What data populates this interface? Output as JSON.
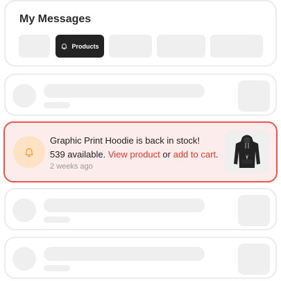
{
  "header": {
    "title": "My Messages",
    "tabs": [
      {
        "label": ""
      },
      {
        "label": "Products",
        "icon": "bell-icon",
        "active": true
      },
      {
        "label": ""
      },
      {
        "label": ""
      },
      {
        "label": ""
      }
    ]
  },
  "notification": {
    "line1": "Graphic Print Hoodie is back in stock!",
    "count_text": "539 available.",
    "view_link": "View product",
    "or_text": "or",
    "cart_link": "add to cart",
    "period": ".",
    "time": "2 weeks ago",
    "icon": "bell-icon",
    "thumbnail": "hoodie-image"
  },
  "colors": {
    "accent": "#e5392c",
    "highlight_bg": "#fdecec",
    "highlight_border": "#f0564a",
    "icon_bg": "#fde2c4",
    "active_tab_bg": "#232323"
  }
}
